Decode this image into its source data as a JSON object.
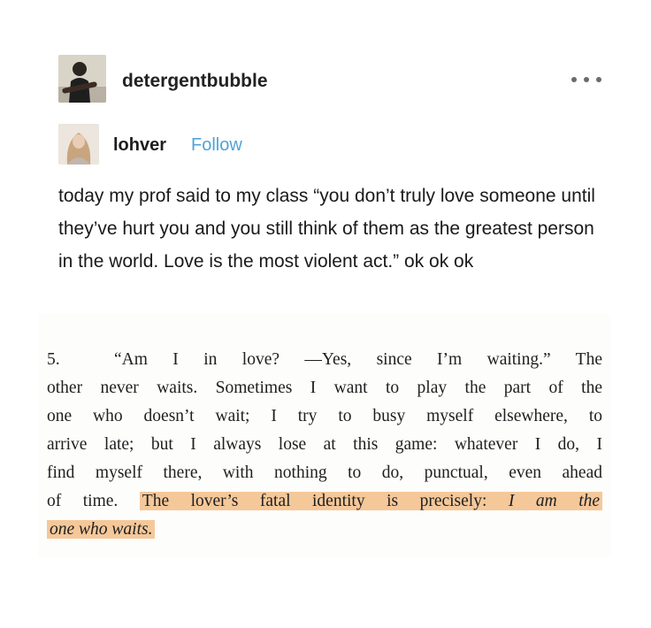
{
  "post": {
    "username": "detergentbubble",
    "reblog": {
      "name": "lohver",
      "follow_label": "Follow",
      "text": "today my prof said to my class “you don’t truly love someone until they’ve hurt you and you still think of them as the greatest person in the world. Love is the most violent act.” ok ok ok"
    }
  },
  "excerpt": {
    "number": "5.",
    "line1": "“Am I in love? —Yes, since I’m waiting.” The",
    "line2": "other never waits. Sometimes I want to play the part of the",
    "line3": "one who doesn’t wait; I try to busy myself elsewhere, to",
    "line4": "arrive late; but I always lose at this game: whatever I do, I",
    "line5": "find myself there, with nothing to do, punctual, even ahead",
    "line6_plain": "of time.",
    "line6_highlight": "The lover’s fatal identity is precisely:",
    "line6_italic": "I am the",
    "line7_italic": "one who waits."
  },
  "colors": {
    "follow": "#4fa3d9",
    "highlight": "#f5c89a",
    "more_dots": "#6b6b6b"
  }
}
